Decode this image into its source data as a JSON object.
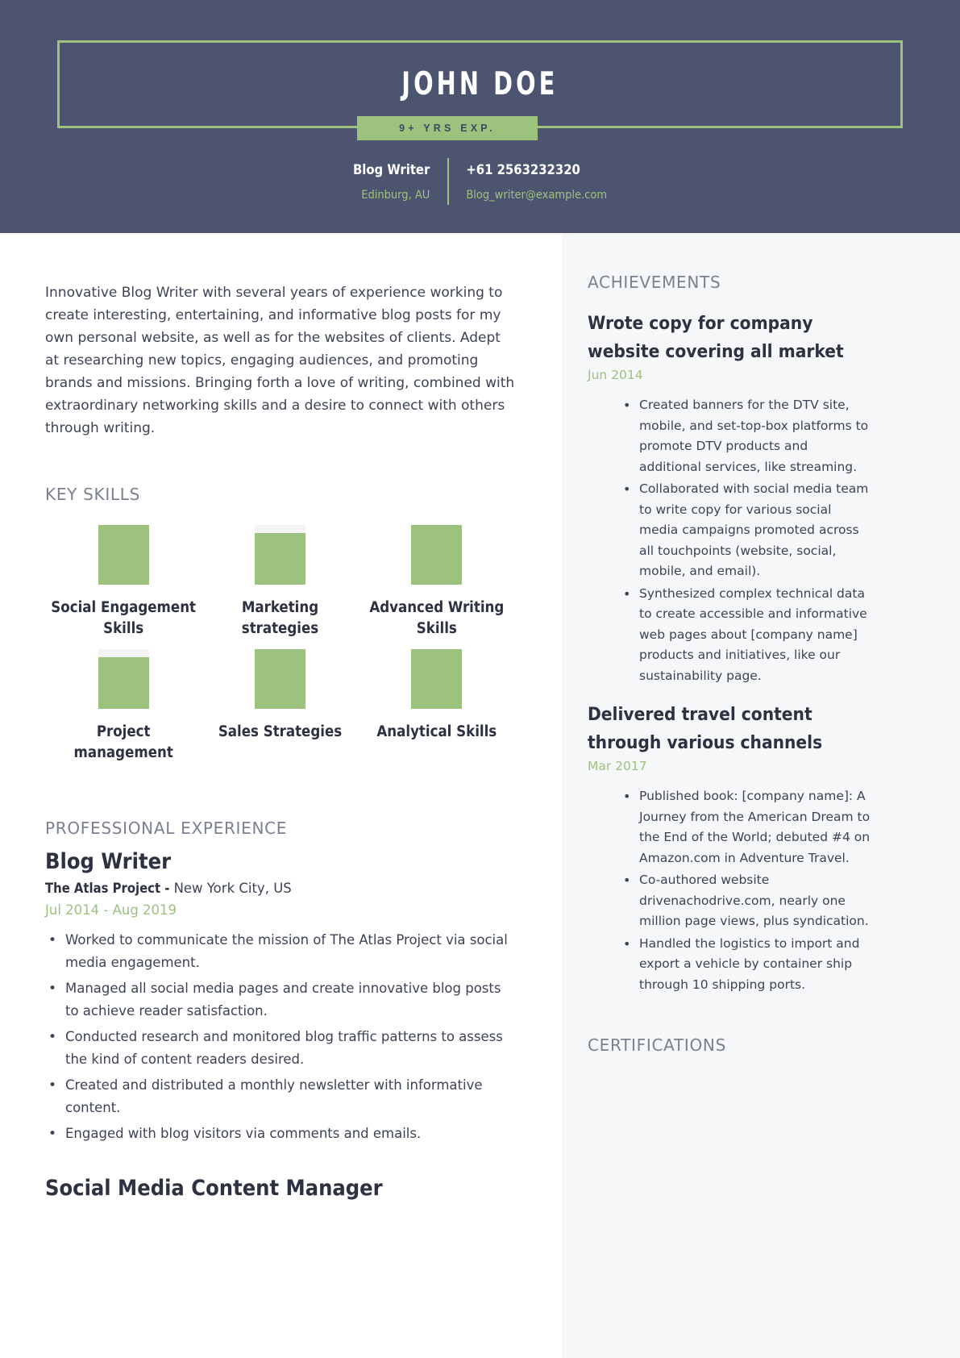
{
  "theme": {
    "header_bg": "#4c5470",
    "accent_green": "#9cc27e",
    "sidebar_bg": "#f6f7f8",
    "text_dark": "#2d3142",
    "text_body": "#3d4354",
    "heading_muted": "#7b8190",
    "bar_track": "#f4f4f4"
  },
  "header": {
    "name": "JOHN DOE",
    "experience_badge": "9+ YRS EXP.",
    "job_title": "Blog Writer",
    "phone": "+61 2563232320",
    "location": "Edinburg, AU",
    "email": "Blog_writer@example.com"
  },
  "summary": {
    "text": "Innovative Blog Writer with several years of experience working to create interesting, entertaining, and informative blog posts for my own personal website, as well as for the websites of clients. Adept at researching new topics, engaging audiences, and promoting brands and missions. Bringing forth a love of writing, combined with extraordinary networking skills and a desire to connect with others through writing."
  },
  "key_skills": {
    "heading": "KEY SKILLS",
    "items": [
      {
        "label": "Social Engagement Skills",
        "level": 100
      },
      {
        "label": "Marketing strategies",
        "level": 86
      },
      {
        "label": "Advanced Writing Skills",
        "level": 100
      },
      {
        "label": "Project management",
        "level": 86
      },
      {
        "label": "Sales Strategies",
        "level": 100
      },
      {
        "label": "Analytical Skills",
        "level": 100
      }
    ]
  },
  "experience": {
    "heading": "PROFESSIONAL EXPERIENCE",
    "jobs": [
      {
        "title": "Blog Writer",
        "company": "The Atlas Project - ",
        "location": "New York City, US",
        "dates": "Jul 2014 - Aug 2019",
        "bullets": [
          "Worked to communicate the mission of The Atlas Project via social media engagement.",
          "Managed all social media pages and create innovative blog posts to achieve reader satisfaction.",
          "Conducted research and monitored blog traffic patterns to assess the kind of content readers desired.",
          "Created and distributed a monthly newsletter with informative content.",
          "Engaged with blog visitors via comments and emails."
        ]
      },
      {
        "title": "Social Media Content Manager",
        "company": "",
        "location": "",
        "dates": "",
        "bullets": []
      }
    ]
  },
  "achievements": {
    "heading": "ACHIEVEMENTS",
    "items": [
      {
        "title": "Wrote copy for company website covering all market",
        "date": "Jun 2014",
        "bullets": [
          "Created banners for the DTV site, mobile, and set-top-box platforms to promote DTV products and additional services, like streaming.",
          "Collaborated with social media team to write copy for various social media campaigns promoted across all touchpoints (website, social, mobile, and email).",
          "Synthesized complex technical data to create accessible and informative web pages about [company name] products and initiatives, like our sustainability page."
        ]
      },
      {
        "title": "Delivered travel content through various channels",
        "date": "Mar 2017",
        "bullets": [
          "Published book: [company name]: A Journey from the American Dream to the End of the World; debuted #4 on Amazon.com in Adventure Travel.",
          "Co-authored website drivenachodrive.com, nearly one million page views, plus syndication.",
          "Handled the logistics to import and export a vehicle by container ship through 10 shipping ports."
        ]
      }
    ]
  },
  "certifications": {
    "heading": "CERTIFICATIONS"
  }
}
